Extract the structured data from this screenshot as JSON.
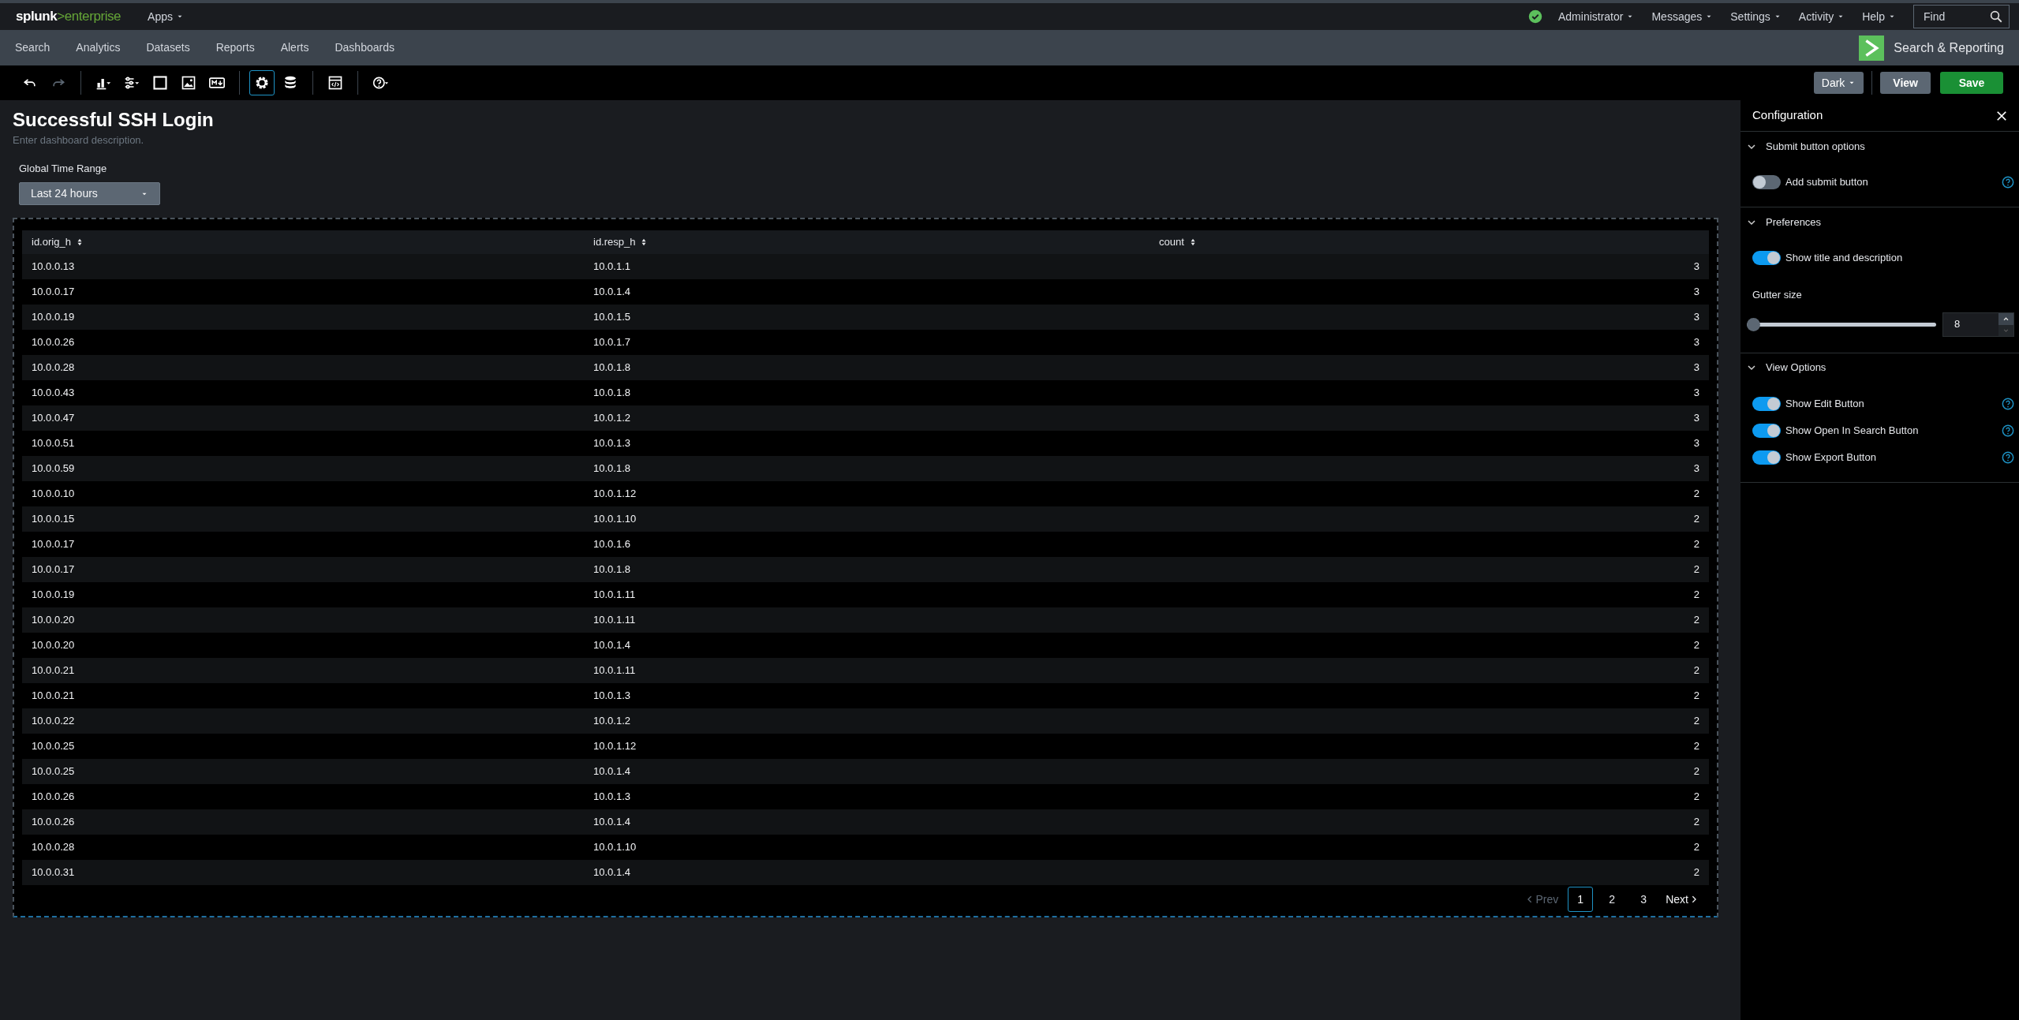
{
  "top_bar": {
    "brand": "splunk",
    "product": ">enterprise",
    "apps_menu": "Apps",
    "menus": [
      "Administrator",
      "Messages",
      "Settings",
      "Activity",
      "Help"
    ],
    "find": {
      "placeholder": "Find"
    }
  },
  "nav": {
    "items": [
      "Search",
      "Analytics",
      "Datasets",
      "Reports",
      "Alerts",
      "Dashboards"
    ],
    "app_name": "Search & Reporting"
  },
  "toolbar": {
    "tool_groups": [
      [
        {
          "kind": "undo",
          "disabled": false,
          "selected": false
        },
        {
          "kind": "redo",
          "disabled": true,
          "selected": false
        }
      ],
      [
        {
          "kind": "chart",
          "disabled": false,
          "selected": false
        },
        {
          "kind": "sliders",
          "disabled": false,
          "selected": false
        },
        {
          "kind": "square",
          "disabled": false,
          "selected": false
        },
        {
          "kind": "image",
          "disabled": false,
          "selected": false
        },
        {
          "kind": "markdown",
          "disabled": false,
          "selected": false
        }
      ],
      [
        {
          "kind": "gear",
          "disabled": false,
          "selected": true
        },
        {
          "kind": "database",
          "disabled": false,
          "selected": false
        }
      ],
      [
        {
          "kind": "code",
          "disabled": false,
          "selected": false
        }
      ],
      [
        {
          "kind": "help",
          "disabled": false,
          "selected": false
        }
      ]
    ],
    "theme": "Dark",
    "view": "View",
    "save": "Save"
  },
  "dashboard": {
    "title": "Successful SSH Login",
    "description": "Enter dashboard description.",
    "time_input": {
      "label": "Global Time Range",
      "value": "Last 24 hours"
    }
  },
  "table": {
    "columns": [
      {
        "label": "id.orig_h"
      },
      {
        "label": "id.resp_h"
      },
      {
        "label": "count"
      }
    ],
    "rows": [
      [
        "10.0.0.13",
        "10.0.1.1",
        "3"
      ],
      [
        "10.0.0.17",
        "10.0.1.4",
        "3"
      ],
      [
        "10.0.0.19",
        "10.0.1.5",
        "3"
      ],
      [
        "10.0.0.26",
        "10.0.1.7",
        "3"
      ],
      [
        "10.0.0.28",
        "10.0.1.8",
        "3"
      ],
      [
        "10.0.0.43",
        "10.0.1.8",
        "3"
      ],
      [
        "10.0.0.47",
        "10.0.1.2",
        "3"
      ],
      [
        "10.0.0.51",
        "10.0.1.3",
        "3"
      ],
      [
        "10.0.0.59",
        "10.0.1.8",
        "3"
      ],
      [
        "10.0.0.10",
        "10.0.1.12",
        "2"
      ],
      [
        "10.0.0.15",
        "10.0.1.10",
        "2"
      ],
      [
        "10.0.0.17",
        "10.0.1.6",
        "2"
      ],
      [
        "10.0.0.17",
        "10.0.1.8",
        "2"
      ],
      [
        "10.0.0.19",
        "10.0.1.11",
        "2"
      ],
      [
        "10.0.0.20",
        "10.0.1.11",
        "2"
      ],
      [
        "10.0.0.20",
        "10.0.1.4",
        "2"
      ],
      [
        "10.0.0.21",
        "10.0.1.11",
        "2"
      ],
      [
        "10.0.0.21",
        "10.0.1.3",
        "2"
      ],
      [
        "10.0.0.22",
        "10.0.1.2",
        "2"
      ],
      [
        "10.0.0.25",
        "10.0.1.12",
        "2"
      ],
      [
        "10.0.0.25",
        "10.0.1.4",
        "2"
      ],
      [
        "10.0.0.26",
        "10.0.1.3",
        "2"
      ],
      [
        "10.0.0.26",
        "10.0.1.4",
        "2"
      ],
      [
        "10.0.0.28",
        "10.0.1.10",
        "2"
      ],
      [
        "10.0.0.31",
        "10.0.1.4",
        "2"
      ]
    ],
    "pagination": {
      "prev": {
        "label": "Prev",
        "disabled": true
      },
      "pages": [
        {
          "label": "1",
          "selected": true
        },
        {
          "label": "2",
          "selected": false
        },
        {
          "label": "3",
          "selected": false
        }
      ],
      "next": {
        "label": "Next",
        "disabled": false
      }
    }
  },
  "config": {
    "title": "Configuration",
    "sections": [
      {
        "title": "Submit button options",
        "expanded": true,
        "items": [
          {
            "kind": "toggle",
            "label": "Add submit button",
            "on": false,
            "help": true
          }
        ]
      },
      {
        "title": "Preferences",
        "expanded": true,
        "items": [
          {
            "kind": "toggle",
            "label": "Show title and description",
            "on": true,
            "help": false
          },
          {
            "kind": "slider",
            "label": "Gutter size",
            "level": 0,
            "value": "8"
          }
        ]
      },
      {
        "title": "View Options",
        "expanded": true,
        "items": [
          {
            "kind": "toggle",
            "label": "Show Edit Button",
            "on": true,
            "help": true
          },
          {
            "kind": "toggle",
            "label": "Show Open In Search Button",
            "on": true,
            "help": true
          },
          {
            "kind": "toggle",
            "label": "Show Export Button",
            "on": true,
            "help": true
          }
        ]
      }
    ]
  }
}
